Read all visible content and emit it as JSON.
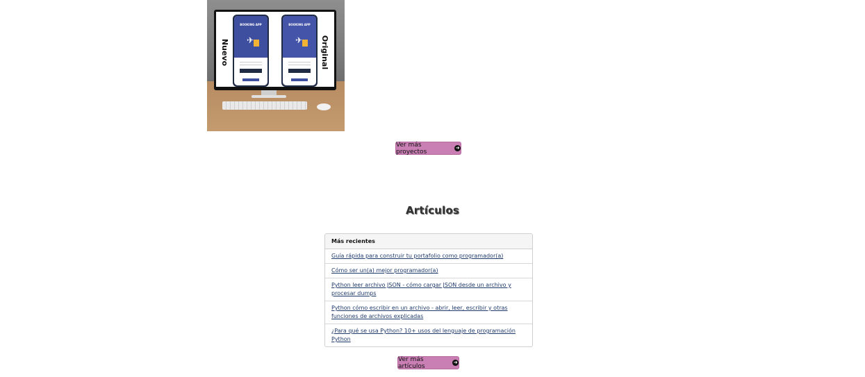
{
  "project_image": {
    "left_label": "Nuevo",
    "right_label": "Original",
    "phone_title": "BOOKING APP",
    "phone_button": "LOREM IPSUM"
  },
  "projects_button": {
    "label": "Ver más proyectos",
    "icon": "arrow-circle-right-icon"
  },
  "articles": {
    "title": "Artículos",
    "header": "Más recientes",
    "items": [
      "Guía rápida para construir tu portafolio como programador(a)",
      "Cómo ser un(a) mejor programador(a)",
      "Python leer archivo JSON - cómo cargar JSON desde un archivo y procesar dumps",
      "Python cómo escribir en un archivo - abrir, leer, escribir y otras funciones de archivos explicadas",
      "¿Para qué se usa Python? 10+ usos del lenguaje de programación Python"
    ]
  },
  "articles_button": {
    "label": "Ver más artículos",
    "icon": "arrow-circle-right-icon"
  },
  "colors": {
    "button_bg": "#c97fb4",
    "link": "#1f3b6b"
  }
}
